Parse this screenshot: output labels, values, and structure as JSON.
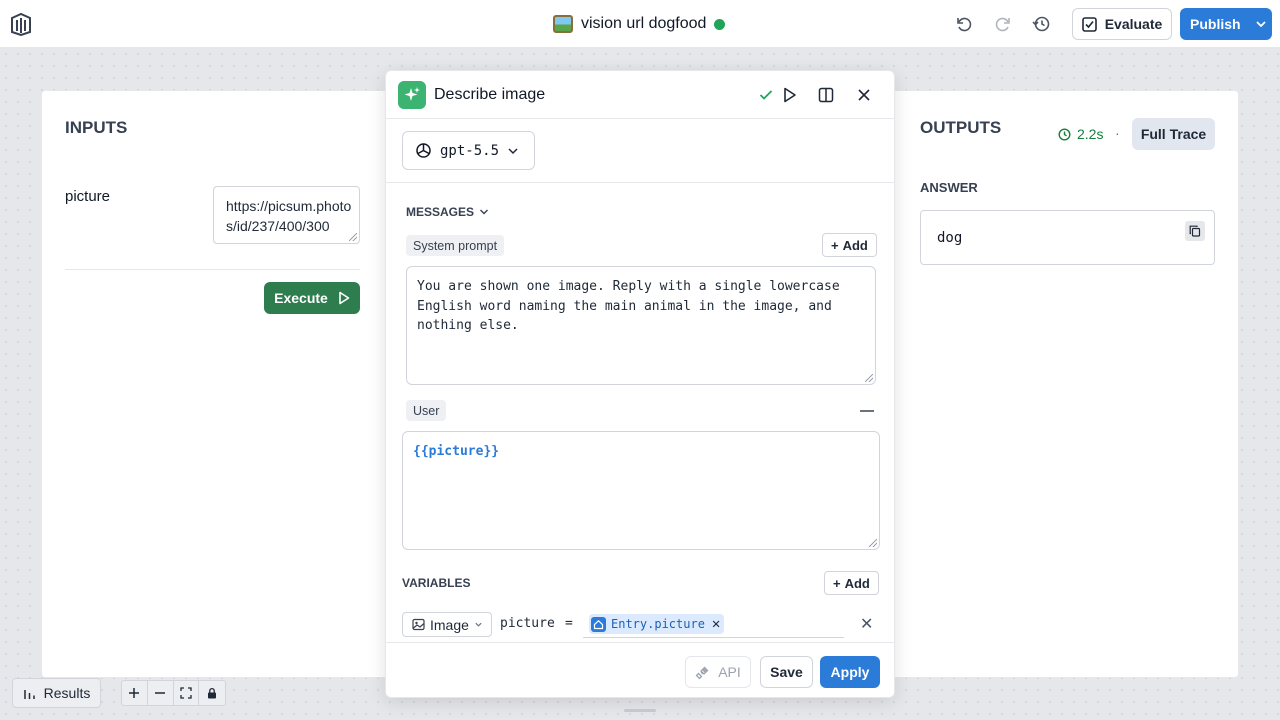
{
  "header": {
    "title": "vision url dogfood",
    "status_color": "#22a35a",
    "evaluate_label": "Evaluate",
    "publish_label": "Publish",
    "icons": [
      "logo-icon",
      "undo-icon",
      "redo-icon",
      "history-icon",
      "checkbox-icon",
      "chevron-down-icon"
    ]
  },
  "inputs": {
    "heading": "INPUTS",
    "fields": [
      {
        "label": "picture",
        "value": "https://picsum.photos/id/237/400/300"
      }
    ],
    "execute_label": "Execute"
  },
  "outputs": {
    "heading": "OUTPUTS",
    "duration": "2.2s",
    "separator": "·",
    "full_trace_label": "Full Trace",
    "answer_label": "ANSWER",
    "answer_value": "dog"
  },
  "panel": {
    "title": "Describe image",
    "model": "gpt-5.5",
    "messages_label": "MESSAGES",
    "system_tag": "System prompt",
    "add_label": "Add",
    "system_prompt": "You are shown one image. Reply with a single lowercase English word naming the main animal in the image, and nothing else.",
    "user_tag": "User",
    "user_message": "{{picture}}",
    "variables_label": "VARIABLES",
    "variable": {
      "type": "Image",
      "name": "picture",
      "equals": "=",
      "value": "Entry.picture"
    },
    "api_label": "API",
    "save_label": "Save",
    "apply_label": "Apply"
  },
  "footer": {
    "results_label": "Results"
  },
  "colors": {
    "primary": "#2b7bd8",
    "execute": "#2e7d4f",
    "success": "#15803d"
  }
}
